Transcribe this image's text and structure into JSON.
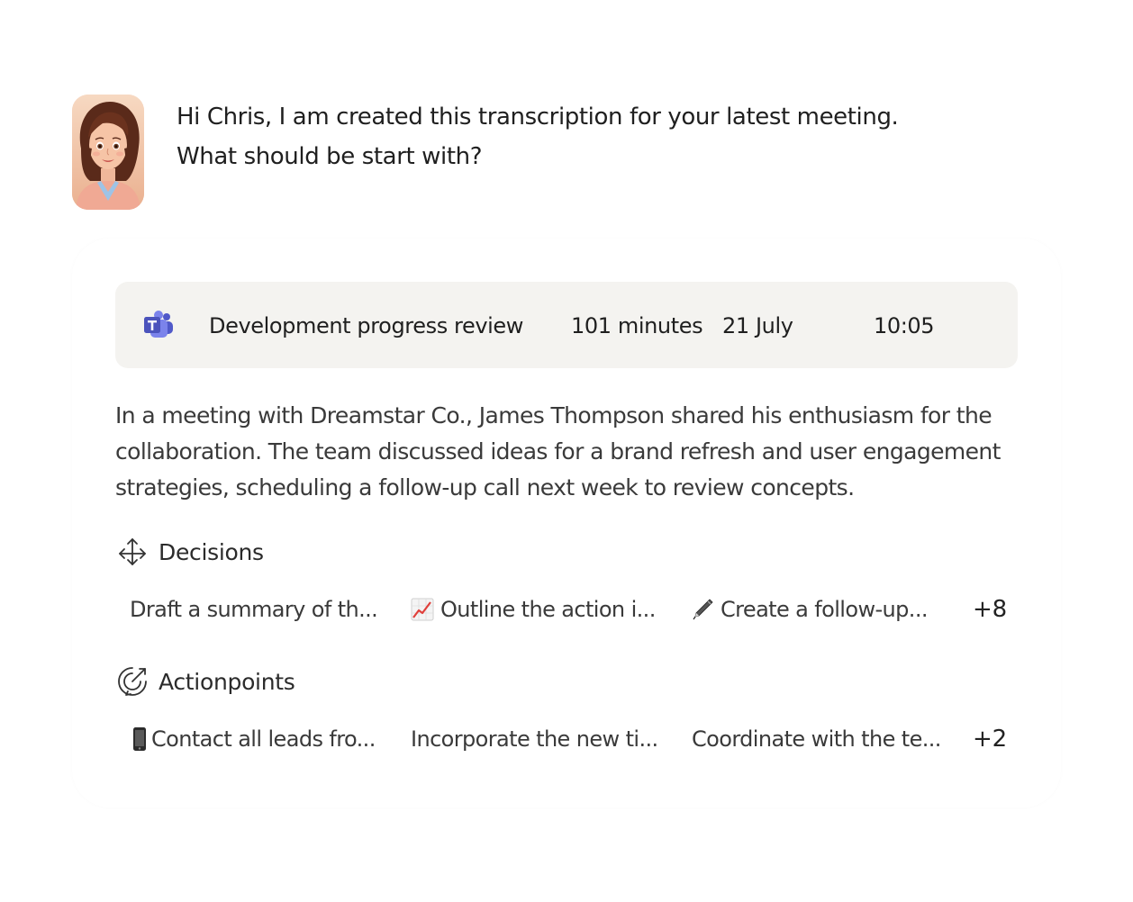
{
  "assistant": {
    "avatar": "assistant-avatar",
    "greeting_line1": "Hi Chris, I am created this transcription for your latest meeting.",
    "greeting_line2": "What should be start with?"
  },
  "meeting": {
    "app_icon": "teams-icon",
    "title": "Development progress review",
    "duration": "101 minutes",
    "date": "21 July",
    "time": "10:05"
  },
  "summary": {
    "line1": "In a meeting with Dreamstar Co., James Thompson shared his enthusiasm for the",
    "line2": "collaboration. The team discussed ideas for a brand refresh and user engagement",
    "line3": "strategies, scheduling a follow-up call next week to review concepts."
  },
  "decisions": {
    "icon": "arrows-move-icon",
    "title": "Decisions",
    "items": [
      {
        "label": "Draft a summary of th...",
        "icon": ""
      },
      {
        "label": "Outline the action i...",
        "icon": "chart-increasing-icon"
      },
      {
        "label": "Create a follow-up...",
        "icon": "pen-icon"
      }
    ],
    "more": "+8"
  },
  "actionpoints": {
    "icon": "rocket-target-icon",
    "title": "Actionpoints",
    "items": [
      {
        "label": "Contact all leads fro...",
        "icon": "mobile-phone-icon"
      },
      {
        "label": "Incorporate the new ti...",
        "icon": ""
      },
      {
        "label": "Coordinate with the te...",
        "icon": ""
      }
    ],
    "more": "+2"
  },
  "colors": {
    "meeting_bar_bg": "#f4f3f0",
    "teams_purple": "#5059c9",
    "text_primary": "#1f1f1f",
    "text_secondary": "#3a3a3a"
  }
}
